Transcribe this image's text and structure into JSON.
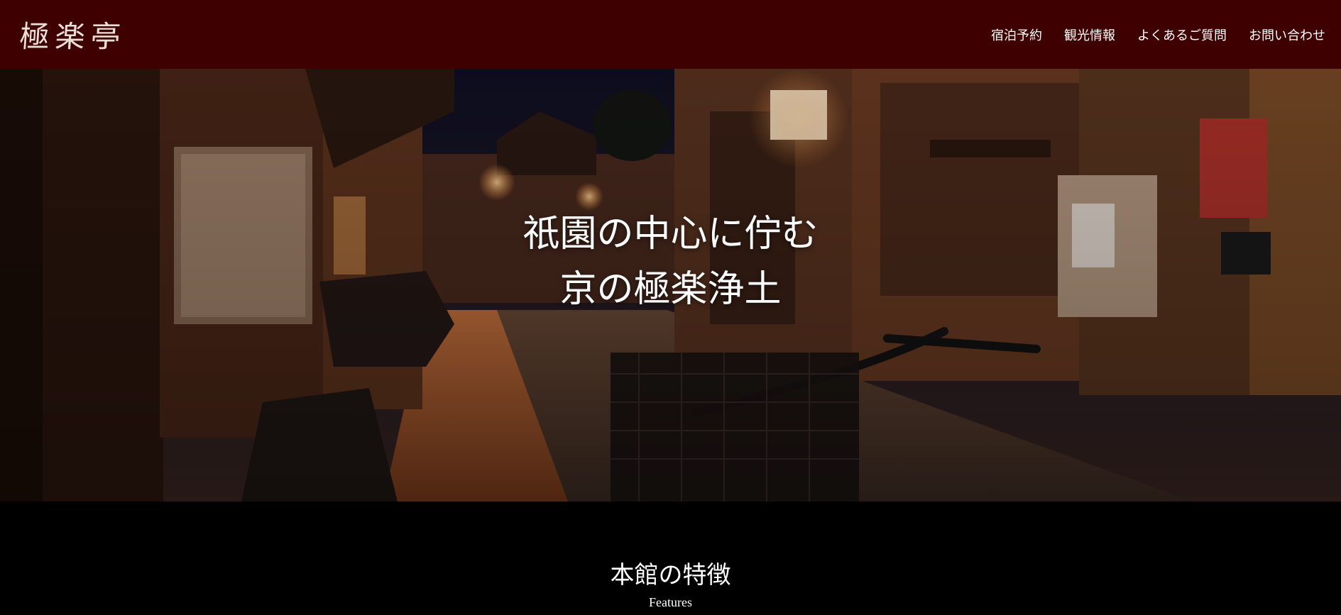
{
  "header": {
    "logo": "極楽亭",
    "nav": [
      {
        "label": "宿泊予約"
      },
      {
        "label": "観光情報"
      },
      {
        "label": "よくあるご質問"
      },
      {
        "label": "お問い合わせ"
      }
    ]
  },
  "hero": {
    "title_line1": "祇園の中心に佇む",
    "title_line2": "京の極楽浄土"
  },
  "features": {
    "heading": "本館の特徴",
    "subheading": "Features"
  },
  "colors": {
    "header_bg": "#3f0002",
    "page_bg": "#000000"
  }
}
